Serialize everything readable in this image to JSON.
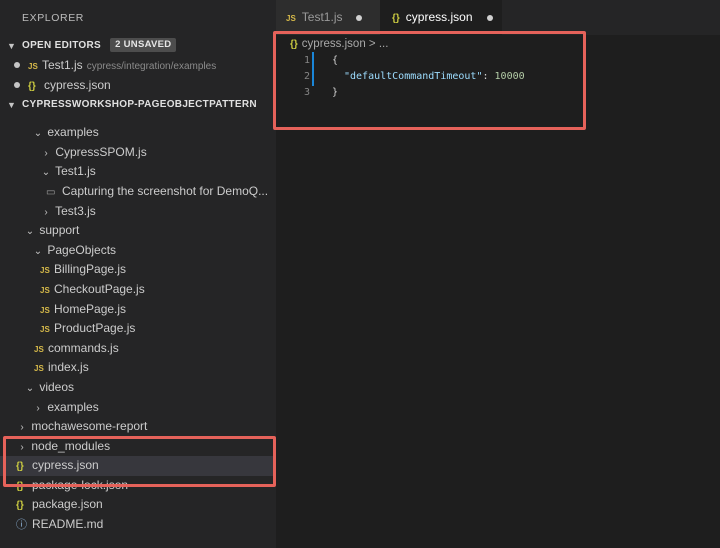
{
  "sidebar": {
    "title": "EXPLORER",
    "open_editors": {
      "label": "OPEN EDITORS",
      "badge": "2 UNSAVED",
      "items": [
        {
          "name": "Test1.js",
          "description": "cypress/integration/examples"
        },
        {
          "name": "cypress.json"
        }
      ]
    },
    "workspace_label": "CYPRESSWORKSHOP-PAGEOBJECTPATTERN",
    "tree": [
      {
        "label": "examples"
      },
      {
        "label": "CypressSPOM.js"
      },
      {
        "label": "Test1.js"
      },
      {
        "label": "Capturing the screenshot for DemoQ..."
      },
      {
        "label": "Test3.js"
      },
      {
        "label": "support"
      },
      {
        "label": "PageObjects"
      },
      {
        "label": "BillingPage.js"
      },
      {
        "label": "CheckoutPage.js"
      },
      {
        "label": "HomePage.js"
      },
      {
        "label": "ProductPage.js"
      },
      {
        "label": "commands.js"
      },
      {
        "label": "index.js"
      },
      {
        "label": "videos"
      },
      {
        "label": "examples"
      },
      {
        "label": "mochawesome-report"
      },
      {
        "label": "node_modules"
      },
      {
        "label": "cypress.json"
      },
      {
        "label": "package-lock.json"
      },
      {
        "label": "package.json"
      },
      {
        "label": "README.md"
      }
    ]
  },
  "tabs": [
    {
      "label": "Test1.js",
      "icon": "js-file-icon"
    },
    {
      "label": "cypress.json",
      "icon": "json-file-icon"
    }
  ],
  "editor": {
    "breadcrumb_file": "cypress.json",
    "breadcrumb_rest": "> ...",
    "line_numbers": [
      "1",
      "2",
      "3"
    ],
    "line1": "{",
    "line2_key": "\"defaultCommandTimeout\"",
    "line2_sep": ": ",
    "line2_value": "10000",
    "line3": "}"
  },
  "colors": {
    "highlight_box": "#e5625a",
    "sidebar_bg": "#252526",
    "editor_bg": "#1e1e1e",
    "js_icon": "#d7ba4a",
    "json_icon": "#cbcb41"
  }
}
